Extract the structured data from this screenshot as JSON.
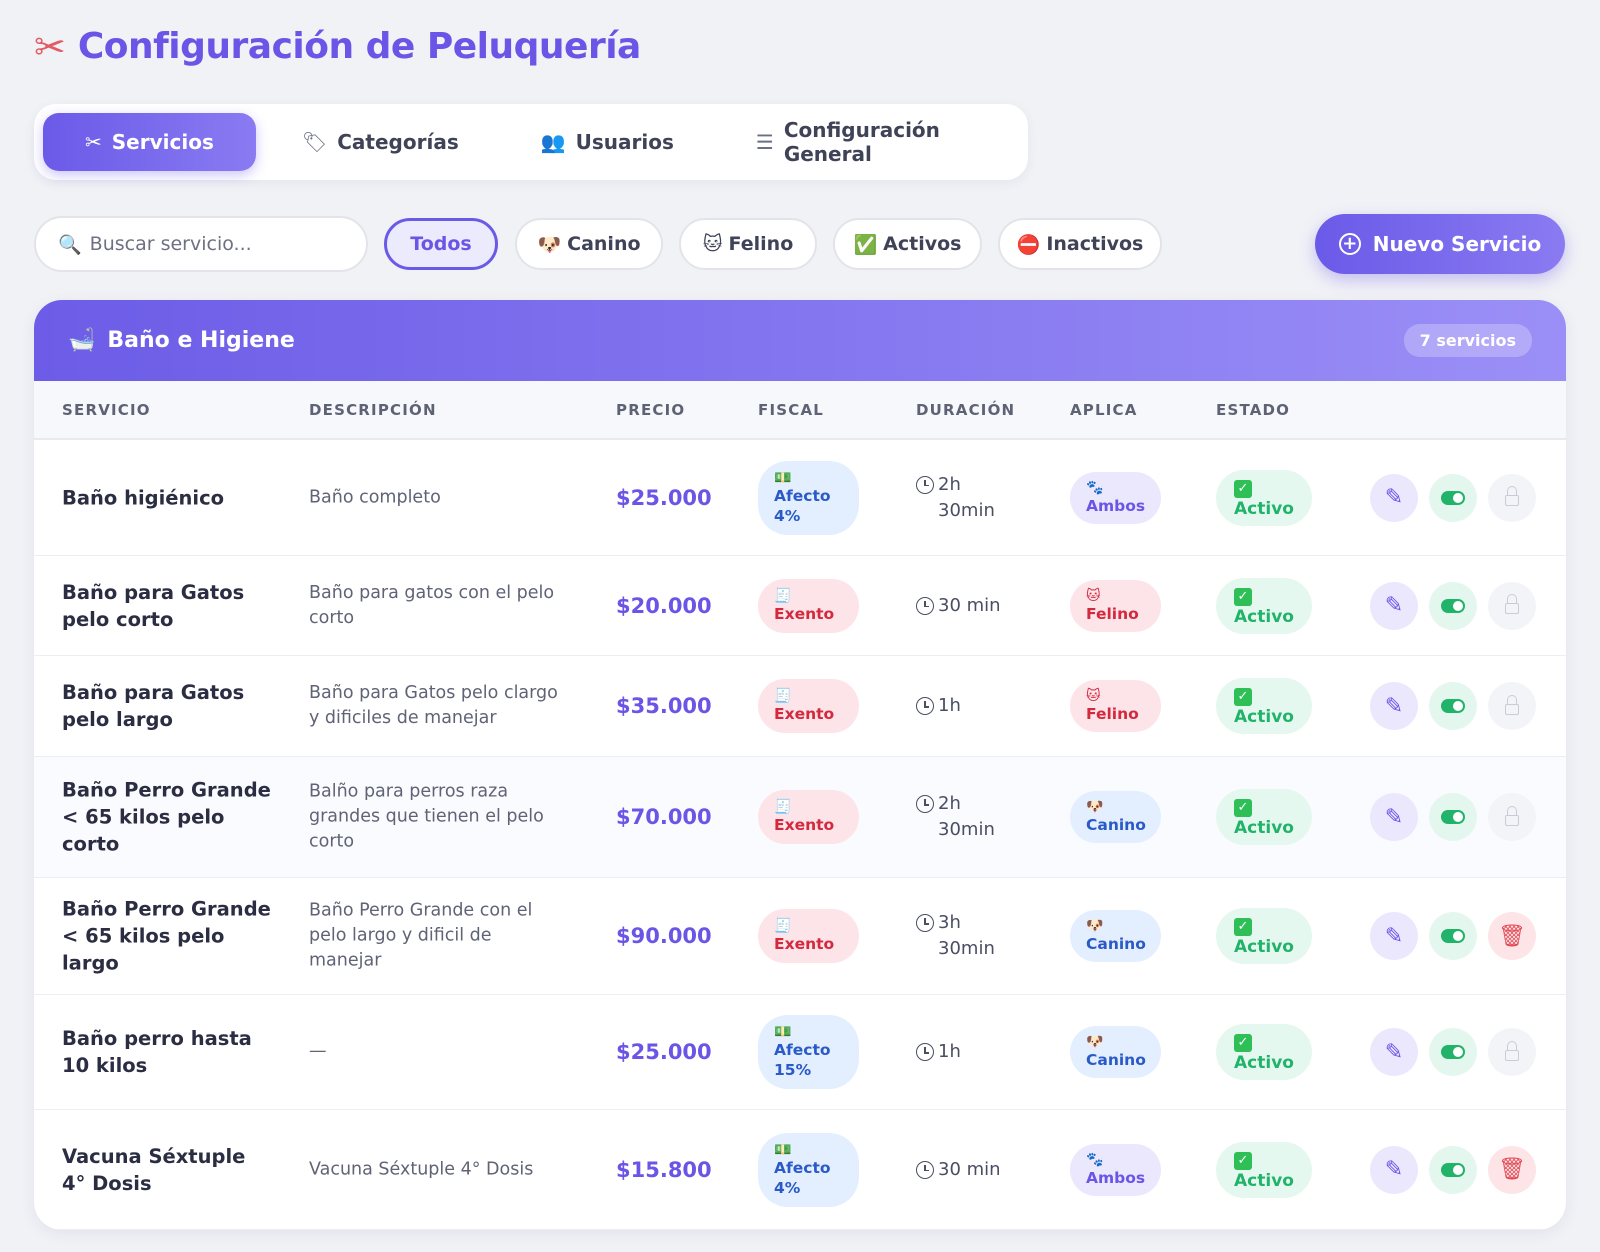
{
  "header": {
    "title": "Configuración de Peluquería",
    "icon": "scissors-icon"
  },
  "tabs": [
    {
      "label": "Servicios",
      "icon": "scissors-icon",
      "active": true
    },
    {
      "label": "Categorías",
      "icon": "tag-icon",
      "active": false
    },
    {
      "label": "Usuarios",
      "icon": "users-icon",
      "active": false
    },
    {
      "label": "Configuración General",
      "icon": "sliders-icon",
      "active": false
    }
  ],
  "search": {
    "placeholder": "Buscar servicio...",
    "value": ""
  },
  "filters": [
    {
      "label": "Todos",
      "icon": "",
      "active": true
    },
    {
      "label": "Canino",
      "icon": "🐶",
      "active": false
    },
    {
      "label": "Felino",
      "icon": "🐱",
      "active": false
    },
    {
      "label": "Activos",
      "icon": "✅",
      "active": false
    },
    {
      "label": "Inactivos",
      "icon": "⛔",
      "active": false
    }
  ],
  "new_button": {
    "label": "Nuevo Servicio"
  },
  "category": {
    "icon": "🛁",
    "name": "Baño e Higiene",
    "count_label": "7 servicios"
  },
  "columns": [
    "SERVICIO",
    "DESCRIPCIÓN",
    "PRECIO",
    "FISCAL",
    "DURACIÓN",
    "APLICA",
    "ESTADO"
  ],
  "rows": [
    {
      "name": "Baño higiénico",
      "description": "Baño completo",
      "price": "$25.000",
      "fiscal": "Afecto 4%",
      "fiscal_type": "afecto",
      "duration": "2h 30min",
      "aplica": "Ambos",
      "estado": "Activo",
      "last_action": "lock"
    },
    {
      "name": "Baño para Gatos pelo corto",
      "description": "Baño para gatos con el pelo corto",
      "price": "$20.000",
      "fiscal": "Exento",
      "fiscal_type": "exento",
      "duration": "30 min",
      "aplica": "Felino",
      "estado": "Activo",
      "last_action": "lock"
    },
    {
      "name": "Baño para Gatos pelo largo",
      "description": "Baño para Gatos pelo clargo y dificiles de manejar",
      "price": "$35.000",
      "fiscal": "Exento",
      "fiscal_type": "exento",
      "duration": "1h",
      "aplica": "Felino",
      "estado": "Activo",
      "last_action": "lock"
    },
    {
      "name": "Baño Perro Grande < 65 kilos pelo corto",
      "description": "Balño para perros raza grandes que tienen el pelo corto",
      "price": "$70.000",
      "fiscal": "Exento",
      "fiscal_type": "exento",
      "duration": "2h 30min",
      "aplica": "Canino",
      "estado": "Activo",
      "last_action": "lock"
    },
    {
      "name": "Baño Perro Grande < 65 kilos pelo largo",
      "description": "Baño Perro Grande con el pelo largo y dificil de manejar",
      "price": "$90.000",
      "fiscal": "Exento",
      "fiscal_type": "exento",
      "duration": "3h 30min",
      "aplica": "Canino",
      "estado": "Activo",
      "last_action": "delete"
    },
    {
      "name": "Baño perro hasta 10 kilos",
      "description": "—",
      "price": "$25.000",
      "fiscal": "Afecto 15%",
      "fiscal_type": "afecto",
      "duration": "1h",
      "aplica": "Canino",
      "estado": "Activo",
      "last_action": "lock"
    },
    {
      "name": "Vacuna Séxtuple 4° Dosis",
      "description": "Vacuna Séxtuple 4° Dosis",
      "price": "$15.800",
      "fiscal": "Afecto 4%",
      "fiscal_type": "afecto",
      "duration": "30 min",
      "aplica": "Ambos",
      "estado": "Activo",
      "last_action": "delete"
    }
  ],
  "colors": {
    "accent": "#6a55e6",
    "active_green": "#22b36a",
    "exento_red": "#d3283d",
    "afecto_blue": "#2a5ac7"
  }
}
